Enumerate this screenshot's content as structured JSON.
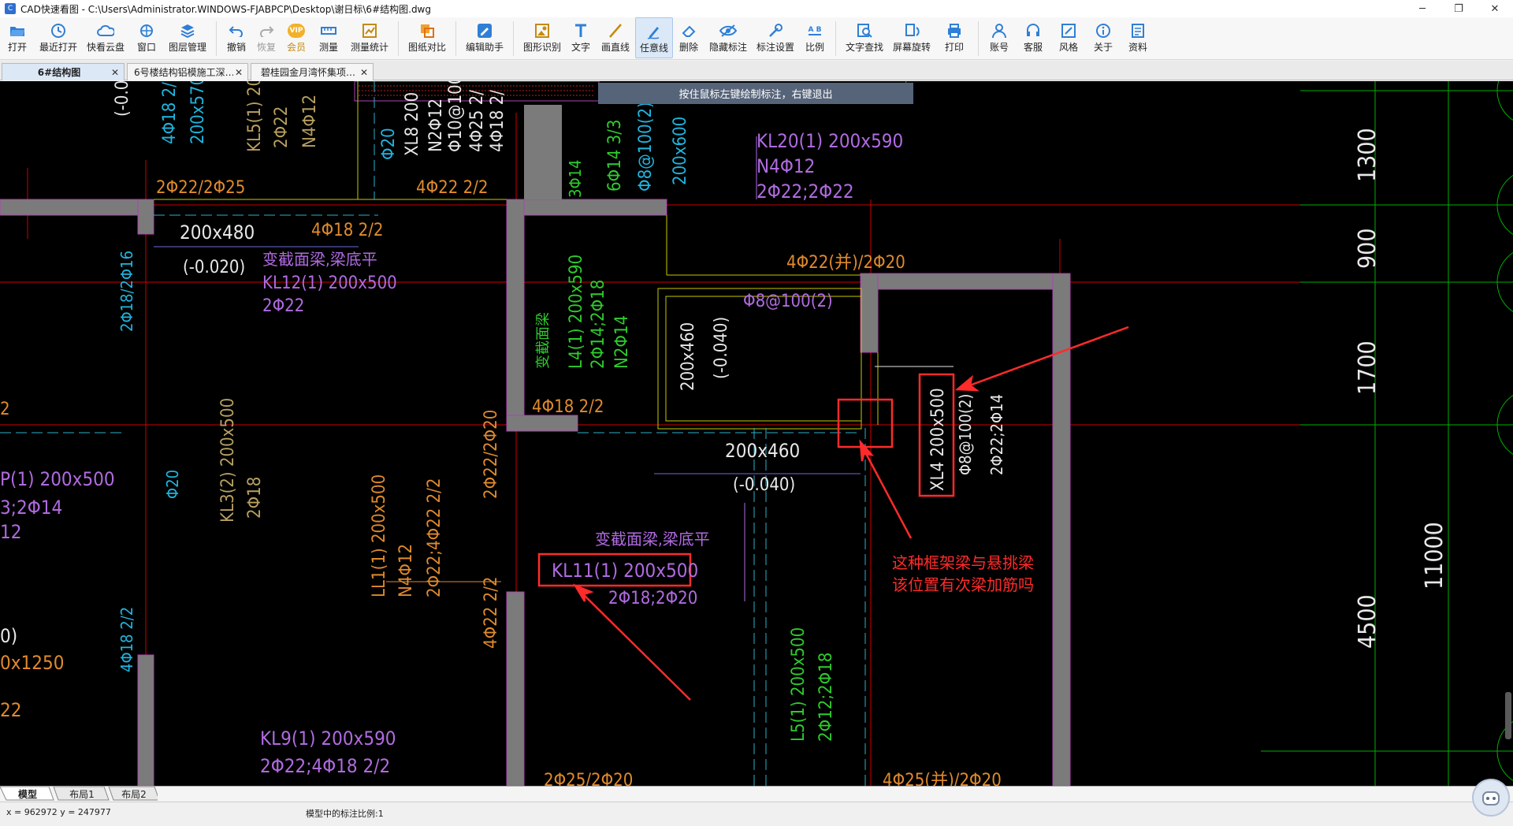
{
  "window": {
    "title": "CAD快速看图 - C:\\Users\\Administrator.WINDOWS-FJABPCP\\Desktop\\谢日标\\6#结构图.dwg",
    "controls": [
      "─",
      "❐",
      "✕"
    ]
  },
  "toolbar": {
    "items": [
      {
        "label": "打开",
        "icon": "folder-open-icon"
      },
      {
        "label": "最近打开",
        "icon": "history-icon"
      },
      {
        "label": "快看云盘",
        "icon": "cloud-icon"
      },
      {
        "label": "窗口",
        "icon": "window-icon"
      },
      {
        "label": "图层管理",
        "icon": "layers-icon"
      },
      {
        "label": "撤销",
        "icon": "undo-icon"
      },
      {
        "label": "恢复",
        "icon": "redo-icon"
      },
      {
        "label": "会员",
        "icon": "vip-icon"
      },
      {
        "label": "测量",
        "icon": "measure-icon"
      },
      {
        "label": "测量统计",
        "icon": "measure-stats-icon"
      },
      {
        "label": "图纸对比",
        "icon": "compare-icon"
      },
      {
        "label": "编辑助手",
        "icon": "edit-assistant-icon"
      },
      {
        "label": "图形识别",
        "icon": "shape-recognition-icon"
      },
      {
        "label": "文字",
        "icon": "text-icon"
      },
      {
        "label": "画直线",
        "icon": "line-icon"
      },
      {
        "label": "任意线",
        "icon": "freehand-icon"
      },
      {
        "label": "删除",
        "icon": "eraser-icon"
      },
      {
        "label": "隐藏标注",
        "icon": "hide-annotation-icon"
      },
      {
        "label": "标注设置",
        "icon": "annotation-settings-icon"
      },
      {
        "label": "比例",
        "icon": "scale-icon"
      },
      {
        "label": "文字查找",
        "icon": "text-search-icon"
      },
      {
        "label": "屏幕旋转",
        "icon": "rotate-screen-icon"
      },
      {
        "label": "打印",
        "icon": "print-icon"
      },
      {
        "label": "账号",
        "icon": "account-icon"
      },
      {
        "label": "客服",
        "icon": "support-icon"
      },
      {
        "label": "风格",
        "icon": "style-icon"
      },
      {
        "label": "关于",
        "icon": "about-icon"
      },
      {
        "label": "资料",
        "icon": "docs-icon"
      }
    ],
    "vip_badge": "VIP",
    "ab_icon_text": "A B"
  },
  "tabs": [
    {
      "label": "6#结构图",
      "close": "✕"
    },
    {
      "label": "6号楼结构铝模施工深…",
      "close": "✕"
    },
    {
      "label": "碧桂园金月湾怀集项…",
      "close": "✕"
    }
  ],
  "canvas": {
    "hint": "按住鼠标左键绘制标注，右键退出",
    "texts": {
      "t01": "(-0.0",
      "t02": "4Φ18 2/",
      "t03": "200x570",
      "t04": "KL5(1) 20",
      "t05": "2Φ22",
      "t06": "N4Φ12",
      "t07": "2Φ22/2Φ25",
      "t08": "Φ20",
      "t09": "XL8 200",
      "t10": "N2Φ12",
      "t11": "Φ10@100",
      "t12": "4Φ25 2/",
      "t13": "4Φ18 2/",
      "t14": "4Φ22 2/2",
      "t15": "3Φ14",
      "t16": "6Φ14 3/3",
      "t17": "Φ8@100(2)",
      "t18": "200x600",
      "t19": "KL20(1) 200x590",
      "t20": "N4Φ12",
      "t21": "2Φ22;2Φ22",
      "t22": "200x480",
      "t23": "4Φ18 2/2",
      "t24": "(-0.020)",
      "t25": "变截面梁,梁底平",
      "t26": "KL12(1) 200x500",
      "t27": "2Φ22",
      "t28": "4Φ22(并)/2Φ20",
      "t29": "2Φ18/2Φ16",
      "t30": "变截面梁",
      "t31": "L4(1) 200x590",
      "t32": "2Φ14;2Φ18",
      "t33": "N2Φ14",
      "t34": "Φ8@100(2)",
      "t35": "200x460",
      "t36": "(-0.040)",
      "t37": "4Φ18 2/2",
      "t38": "1300",
      "t39": "900",
      "t40": "1700",
      "t41": "XL4 200x500",
      "t42": "Φ8@100(2)",
      "t43": "2Φ22;2Φ14",
      "t44": "200x460",
      "t45": "(-0.040)",
      "t46": "2",
      "t47": "Φ20",
      "t48": "KL3(2) 200x500",
      "t49": "2Φ18",
      "t50": "LL1(1) 200x500",
      "t51": "N4Φ12",
      "t52": "2Φ22;4Φ22 2/2",
      "t53": "2Φ22/2Φ20",
      "t54": "P(1) 200x500",
      "t55": "3;2Φ14",
      "t56": "12",
      "t57": "变截面梁,梁底平",
      "t58": "KL11(1) 200x500",
      "t59": "2Φ18;2Φ20",
      "t60": "这种框架梁与悬挑梁",
      "t61": "该位置有次梁加筋吗",
      "t62": "11000",
      "t63": "4500",
      "t64": "4Φ22 2/2",
      "t65": "4Φ18 2/2",
      "t66": "0)",
      "t67": "0x1250",
      "t68": "22",
      "t69": "L5(1) 200x500",
      "t70": "2Φ12;2Φ18",
      "t71": "KL9(1) 200x590",
      "t72": "2Φ22;4Φ18 2/2",
      "t73": "2Φ25/2Φ20",
      "t74": "4Φ25(并)/2Φ20"
    }
  },
  "layout_tabs": [
    "模型",
    "布局1",
    "布局2"
  ],
  "status": {
    "coords": "x = 962972  y = 247977",
    "scale": "模型中的标注比例:1"
  },
  "colors": {
    "canvas_bg": "#000000",
    "axis_red": "#ff0000",
    "axis_green": "#00c800",
    "wall_gray": "#808080",
    "wall_magenta": "#b040b0",
    "beam_yellow": "#e0e000",
    "text_purple": "#b06be0",
    "text_orange": "#e08a2c",
    "text_cyan": "#1fb6e0",
    "text_green": "#2ecc2e",
    "text_white": "#e8e8e8",
    "annotation_red": "#ff2b2b"
  }
}
